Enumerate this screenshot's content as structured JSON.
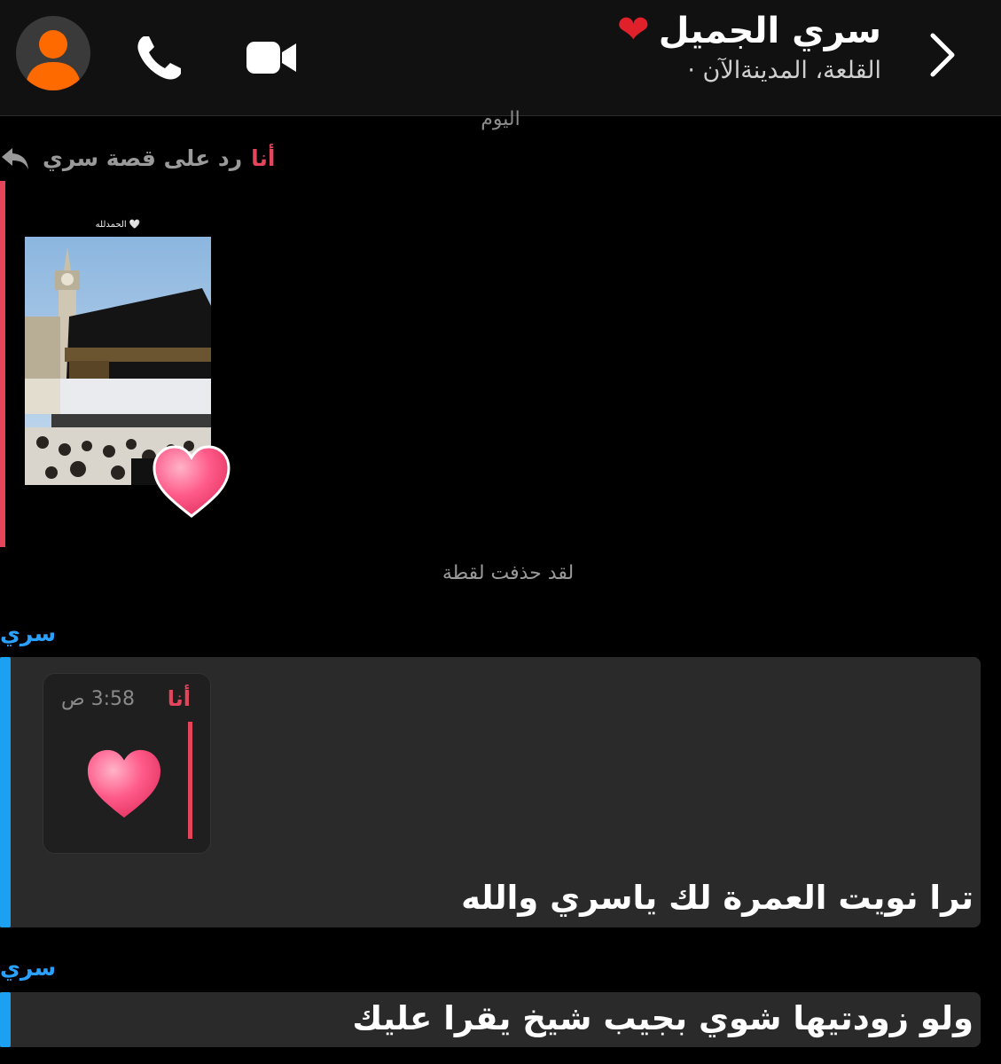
{
  "header": {
    "contact_name": "سري الجميل",
    "status": "القلعة، المدينةالآن ·"
  },
  "chat": {
    "day_label": "اليوم",
    "story_reply": {
      "me_name": "أنا",
      "reply_label": "رد على قصة سري",
      "story_tag": "الحمدلله 🤍"
    },
    "snap_deleted": "لقد حذفت لقطة",
    "messages": [
      {
        "sender": "سري",
        "quoted": {
          "name": "أنا",
          "time": "3:58 ص"
        },
        "text": "ترا نويت العمرة لك ياسري والله"
      },
      {
        "sender": "سري",
        "text": "ولو زودتيها شوي بجيب شيخ يقرا عليك"
      }
    ]
  },
  "colors": {
    "me": "#e4455a",
    "friend": "#2aa0ff",
    "bubble": "#2a2a2a",
    "friend_bar": "#1ca0f2"
  }
}
